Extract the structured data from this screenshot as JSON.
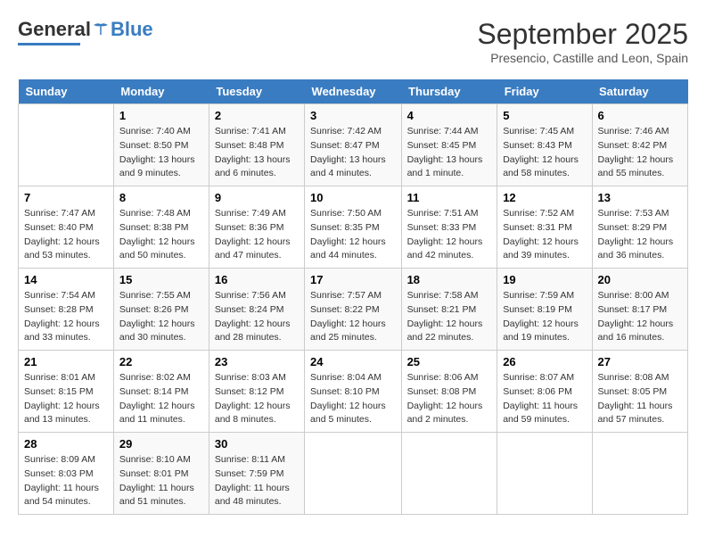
{
  "header": {
    "logo_general": "General",
    "logo_blue": "Blue",
    "month_title": "September 2025",
    "location": "Presencio, Castille and Leon, Spain"
  },
  "columns": [
    "Sunday",
    "Monday",
    "Tuesday",
    "Wednesday",
    "Thursday",
    "Friday",
    "Saturday"
  ],
  "weeks": [
    [
      {
        "num": "",
        "sunrise": "",
        "sunset": "",
        "daylight": ""
      },
      {
        "num": "1",
        "sunrise": "Sunrise: 7:40 AM",
        "sunset": "Sunset: 8:50 PM",
        "daylight": "Daylight: 13 hours and 9 minutes."
      },
      {
        "num": "2",
        "sunrise": "Sunrise: 7:41 AM",
        "sunset": "Sunset: 8:48 PM",
        "daylight": "Daylight: 13 hours and 6 minutes."
      },
      {
        "num": "3",
        "sunrise": "Sunrise: 7:42 AM",
        "sunset": "Sunset: 8:47 PM",
        "daylight": "Daylight: 13 hours and 4 minutes."
      },
      {
        "num": "4",
        "sunrise": "Sunrise: 7:44 AM",
        "sunset": "Sunset: 8:45 PM",
        "daylight": "Daylight: 13 hours and 1 minute."
      },
      {
        "num": "5",
        "sunrise": "Sunrise: 7:45 AM",
        "sunset": "Sunset: 8:43 PM",
        "daylight": "Daylight: 12 hours and 58 minutes."
      },
      {
        "num": "6",
        "sunrise": "Sunrise: 7:46 AM",
        "sunset": "Sunset: 8:42 PM",
        "daylight": "Daylight: 12 hours and 55 minutes."
      }
    ],
    [
      {
        "num": "7",
        "sunrise": "Sunrise: 7:47 AM",
        "sunset": "Sunset: 8:40 PM",
        "daylight": "Daylight: 12 hours and 53 minutes."
      },
      {
        "num": "8",
        "sunrise": "Sunrise: 7:48 AM",
        "sunset": "Sunset: 8:38 PM",
        "daylight": "Daylight: 12 hours and 50 minutes."
      },
      {
        "num": "9",
        "sunrise": "Sunrise: 7:49 AM",
        "sunset": "Sunset: 8:36 PM",
        "daylight": "Daylight: 12 hours and 47 minutes."
      },
      {
        "num": "10",
        "sunrise": "Sunrise: 7:50 AM",
        "sunset": "Sunset: 8:35 PM",
        "daylight": "Daylight: 12 hours and 44 minutes."
      },
      {
        "num": "11",
        "sunrise": "Sunrise: 7:51 AM",
        "sunset": "Sunset: 8:33 PM",
        "daylight": "Daylight: 12 hours and 42 minutes."
      },
      {
        "num": "12",
        "sunrise": "Sunrise: 7:52 AM",
        "sunset": "Sunset: 8:31 PM",
        "daylight": "Daylight: 12 hours and 39 minutes."
      },
      {
        "num": "13",
        "sunrise": "Sunrise: 7:53 AM",
        "sunset": "Sunset: 8:29 PM",
        "daylight": "Daylight: 12 hours and 36 minutes."
      }
    ],
    [
      {
        "num": "14",
        "sunrise": "Sunrise: 7:54 AM",
        "sunset": "Sunset: 8:28 PM",
        "daylight": "Daylight: 12 hours and 33 minutes."
      },
      {
        "num": "15",
        "sunrise": "Sunrise: 7:55 AM",
        "sunset": "Sunset: 8:26 PM",
        "daylight": "Daylight: 12 hours and 30 minutes."
      },
      {
        "num": "16",
        "sunrise": "Sunrise: 7:56 AM",
        "sunset": "Sunset: 8:24 PM",
        "daylight": "Daylight: 12 hours and 28 minutes."
      },
      {
        "num": "17",
        "sunrise": "Sunrise: 7:57 AM",
        "sunset": "Sunset: 8:22 PM",
        "daylight": "Daylight: 12 hours and 25 minutes."
      },
      {
        "num": "18",
        "sunrise": "Sunrise: 7:58 AM",
        "sunset": "Sunset: 8:21 PM",
        "daylight": "Daylight: 12 hours and 22 minutes."
      },
      {
        "num": "19",
        "sunrise": "Sunrise: 7:59 AM",
        "sunset": "Sunset: 8:19 PM",
        "daylight": "Daylight: 12 hours and 19 minutes."
      },
      {
        "num": "20",
        "sunrise": "Sunrise: 8:00 AM",
        "sunset": "Sunset: 8:17 PM",
        "daylight": "Daylight: 12 hours and 16 minutes."
      }
    ],
    [
      {
        "num": "21",
        "sunrise": "Sunrise: 8:01 AM",
        "sunset": "Sunset: 8:15 PM",
        "daylight": "Daylight: 12 hours and 13 minutes."
      },
      {
        "num": "22",
        "sunrise": "Sunrise: 8:02 AM",
        "sunset": "Sunset: 8:14 PM",
        "daylight": "Daylight: 12 hours and 11 minutes."
      },
      {
        "num": "23",
        "sunrise": "Sunrise: 8:03 AM",
        "sunset": "Sunset: 8:12 PM",
        "daylight": "Daylight: 12 hours and 8 minutes."
      },
      {
        "num": "24",
        "sunrise": "Sunrise: 8:04 AM",
        "sunset": "Sunset: 8:10 PM",
        "daylight": "Daylight: 12 hours and 5 minutes."
      },
      {
        "num": "25",
        "sunrise": "Sunrise: 8:06 AM",
        "sunset": "Sunset: 8:08 PM",
        "daylight": "Daylight: 12 hours and 2 minutes."
      },
      {
        "num": "26",
        "sunrise": "Sunrise: 8:07 AM",
        "sunset": "Sunset: 8:06 PM",
        "daylight": "Daylight: 11 hours and 59 minutes."
      },
      {
        "num": "27",
        "sunrise": "Sunrise: 8:08 AM",
        "sunset": "Sunset: 8:05 PM",
        "daylight": "Daylight: 11 hours and 57 minutes."
      }
    ],
    [
      {
        "num": "28",
        "sunrise": "Sunrise: 8:09 AM",
        "sunset": "Sunset: 8:03 PM",
        "daylight": "Daylight: 11 hours and 54 minutes."
      },
      {
        "num": "29",
        "sunrise": "Sunrise: 8:10 AM",
        "sunset": "Sunset: 8:01 PM",
        "daylight": "Daylight: 11 hours and 51 minutes."
      },
      {
        "num": "30",
        "sunrise": "Sunrise: 8:11 AM",
        "sunset": "Sunset: 7:59 PM",
        "daylight": "Daylight: 11 hours and 48 minutes."
      },
      {
        "num": "",
        "sunrise": "",
        "sunset": "",
        "daylight": ""
      },
      {
        "num": "",
        "sunrise": "",
        "sunset": "",
        "daylight": ""
      },
      {
        "num": "",
        "sunrise": "",
        "sunset": "",
        "daylight": ""
      },
      {
        "num": "",
        "sunrise": "",
        "sunset": "",
        "daylight": ""
      }
    ]
  ]
}
